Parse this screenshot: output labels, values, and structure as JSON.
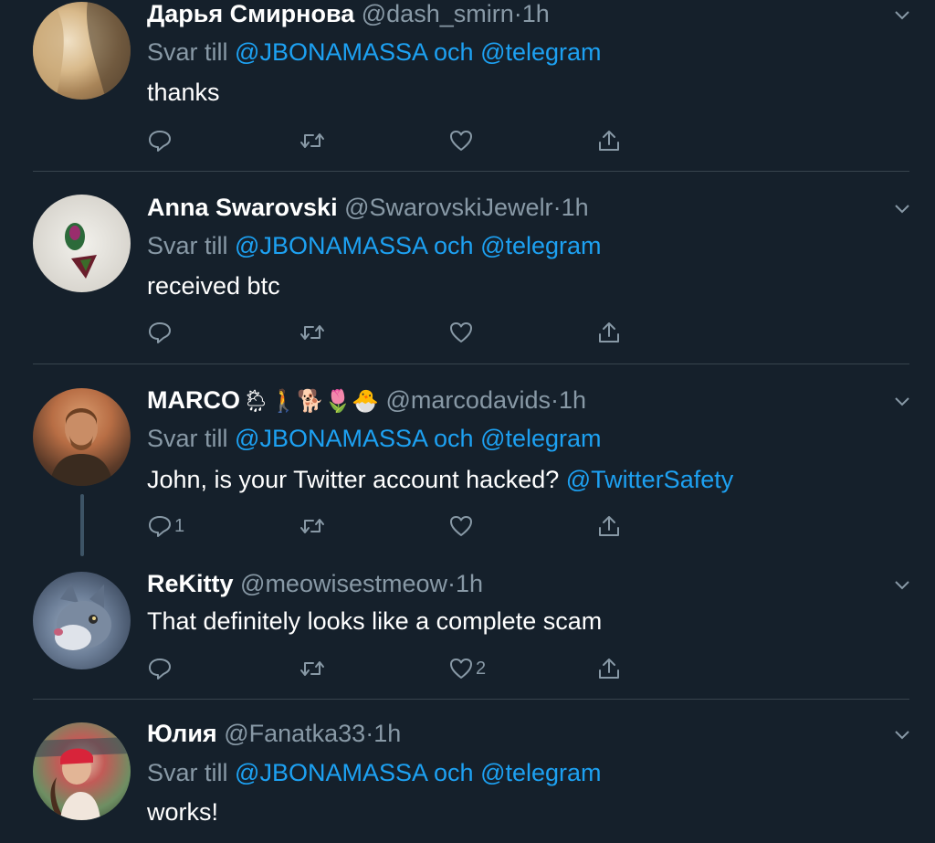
{
  "tweets": [
    {
      "name": "Дарья Смирнова",
      "handle": "@dash_smirn",
      "time": "1h",
      "reply_prefix": "Svar till",
      "reply_user1": "@JBONAMASSA",
      "reply_and": "och",
      "reply_user2": "@telegram",
      "text": "thanks",
      "reply_count": "",
      "like_count": ""
    },
    {
      "name": "Anna Swarovski",
      "handle": "@SwarovskiJewelr",
      "time": "1h",
      "reply_prefix": "Svar till",
      "reply_user1": "@JBONAMASSA",
      "reply_and": "och",
      "reply_user2": "@telegram",
      "text": "received btc",
      "reply_count": "",
      "like_count": ""
    },
    {
      "name": "MARCO",
      "name_emojis": "🌦🚶🐕🌷🐣",
      "handle": "@marcodavids",
      "time": "1h",
      "reply_prefix": "Svar till",
      "reply_user1": "@JBONAMASSA",
      "reply_and": "och",
      "reply_user2": "@telegram",
      "text": "John, is your Twitter account hacked?",
      "text_mention": "@TwitterSafety",
      "reply_count": "1",
      "like_count": ""
    },
    {
      "name": "ReKitty",
      "handle": "@meowisestmeow",
      "time": "1h",
      "text": "That definitely looks like a complete scam",
      "reply_count": "",
      "like_count": "2"
    },
    {
      "name": "Юлия",
      "handle": "@Fanatka33",
      "time": "1h",
      "reply_prefix": "Svar till",
      "reply_user1": "@JBONAMASSA",
      "reply_and": "och",
      "reply_user2": "@telegram",
      "text": "works!"
    }
  ],
  "separator": "·",
  "icons": [
    "reply-icon",
    "retweet-icon",
    "like-icon",
    "share-icon",
    "chevron-down-icon"
  ],
  "colors": {
    "background": "#15202b",
    "link": "#1da1f2",
    "muted": "#8899a6",
    "divider": "#38444d"
  }
}
